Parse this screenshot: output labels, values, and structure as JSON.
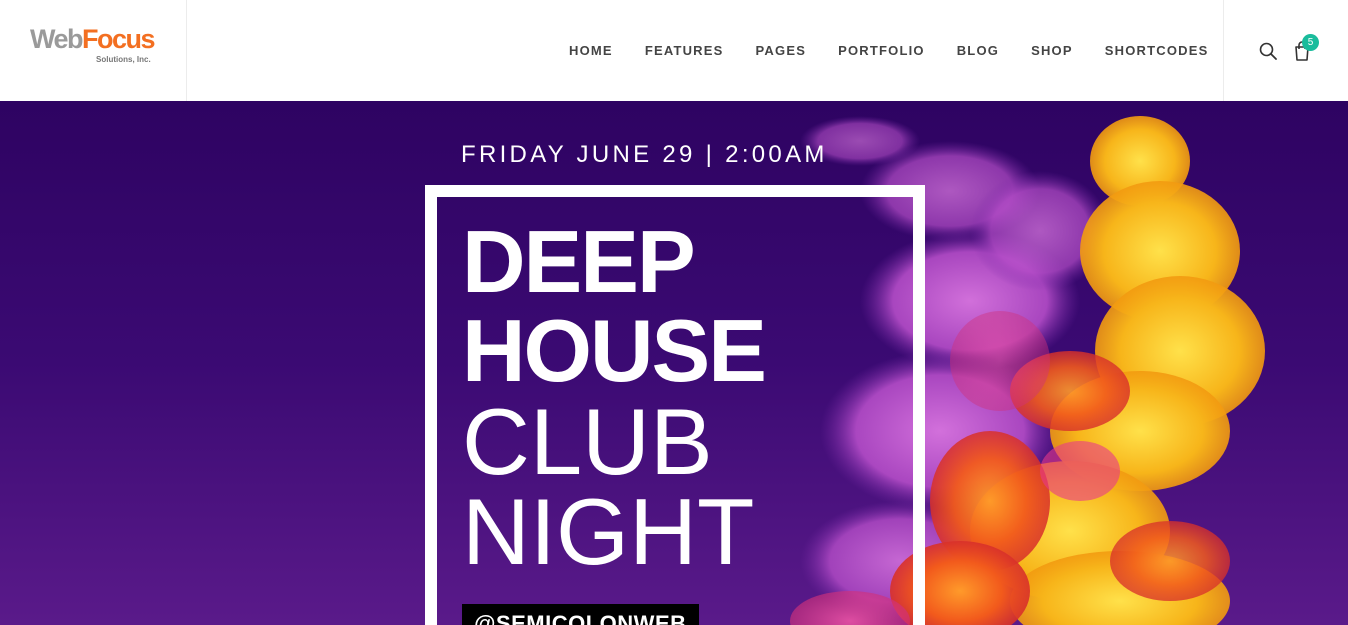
{
  "brand": {
    "logo_web": "Web",
    "logo_focus": "Focus",
    "logo_sub": "Solutions, Inc."
  },
  "nav": {
    "items": [
      {
        "label": "HOME"
      },
      {
        "label": "FEATURES"
      },
      {
        "label": "PAGES"
      },
      {
        "label": "PORTFOLIO"
      },
      {
        "label": "BLOG"
      },
      {
        "label": "SHOP"
      },
      {
        "label": "SHORTCODES"
      }
    ]
  },
  "header_icons": {
    "search": "search-icon",
    "cart": "cart-icon",
    "cart_count": "5"
  },
  "hero": {
    "date": "FRIDAY JUNE 29 | 2:00AM",
    "title_line1": "DEEP",
    "title_line2": "HOUSE",
    "title_line3": "CLUB",
    "title_line4": "NIGHT",
    "handle": "@SEMICOLONWEB"
  },
  "colors": {
    "accent": "#f36f21",
    "badge": "#1abc9c",
    "hero_bg": "#2e0362"
  }
}
